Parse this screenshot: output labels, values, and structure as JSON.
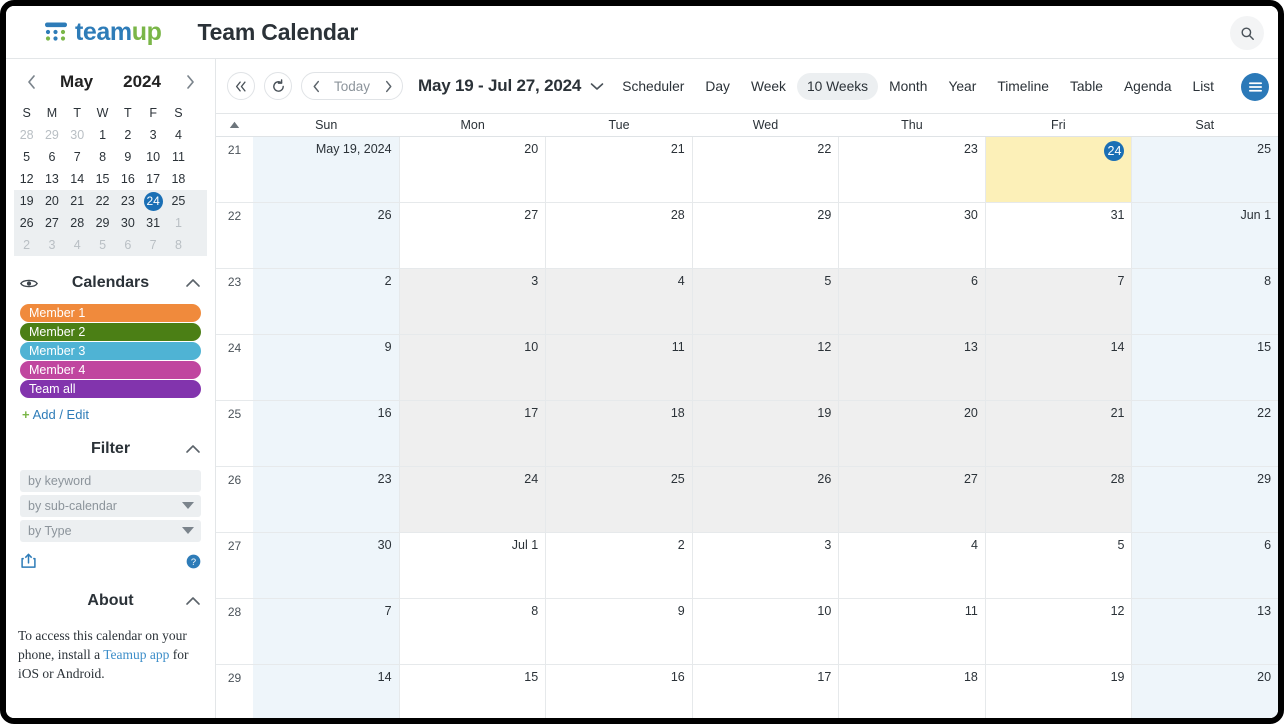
{
  "brand": {
    "logo_team": "team",
    "logo_up": "up",
    "logo_icon": "teamup-dots-logo"
  },
  "header": {
    "calendar_title": "Team Calendar",
    "search_icon": "search-icon"
  },
  "sidebar": {
    "minical": {
      "prev_icon": "chevron-left-icon",
      "next_icon": "chevron-right-icon",
      "month": "May",
      "year": "2024",
      "dow": [
        "S",
        "M",
        "T",
        "W",
        "T",
        "F",
        "S"
      ],
      "weeks": [
        {
          "selected": false,
          "days": [
            {
              "n": "28",
              "out": true
            },
            {
              "n": "29",
              "out": true
            },
            {
              "n": "30",
              "out": true
            },
            {
              "n": "1",
              "out": false
            },
            {
              "n": "2",
              "out": false
            },
            {
              "n": "3",
              "out": false
            },
            {
              "n": "4",
              "out": false
            }
          ]
        },
        {
          "selected": false,
          "days": [
            {
              "n": "5",
              "out": false
            },
            {
              "n": "6",
              "out": false
            },
            {
              "n": "7",
              "out": false
            },
            {
              "n": "8",
              "out": false
            },
            {
              "n": "9",
              "out": false
            },
            {
              "n": "10",
              "out": false
            },
            {
              "n": "11",
              "out": false
            }
          ]
        },
        {
          "selected": false,
          "days": [
            {
              "n": "12",
              "out": false
            },
            {
              "n": "13",
              "out": false
            },
            {
              "n": "14",
              "out": false
            },
            {
              "n": "15",
              "out": false
            },
            {
              "n": "16",
              "out": false
            },
            {
              "n": "17",
              "out": false
            },
            {
              "n": "18",
              "out": false
            }
          ]
        },
        {
          "selected": true,
          "days": [
            {
              "n": "19",
              "out": false
            },
            {
              "n": "20",
              "out": false
            },
            {
              "n": "21",
              "out": false
            },
            {
              "n": "22",
              "out": false
            },
            {
              "n": "23",
              "out": false
            },
            {
              "n": "24",
              "out": false,
              "today": true
            },
            {
              "n": "25",
              "out": false
            }
          ]
        },
        {
          "selected": true,
          "days": [
            {
              "n": "26",
              "out": false
            },
            {
              "n": "27",
              "out": false
            },
            {
              "n": "28",
              "out": false
            },
            {
              "n": "29",
              "out": false
            },
            {
              "n": "30",
              "out": false
            },
            {
              "n": "31",
              "out": false
            },
            {
              "n": "1",
              "out": true
            }
          ]
        },
        {
          "selected": true,
          "days": [
            {
              "n": "2",
              "out": true
            },
            {
              "n": "3",
              "out": true
            },
            {
              "n": "4",
              "out": true
            },
            {
              "n": "5",
              "out": true
            },
            {
              "n": "6",
              "out": true
            },
            {
              "n": "7",
              "out": true
            },
            {
              "n": "8",
              "out": true
            }
          ]
        }
      ]
    },
    "calendars_section": {
      "eye_icon": "eye-icon",
      "title": "Calendars",
      "collapse_icon": "chevron-up-icon",
      "items": [
        {
          "label": "Member 1",
          "color": "#f08a3c"
        },
        {
          "label": "Member 2",
          "color": "#4b7f15"
        },
        {
          "label": "Member 3",
          "color": "#4fb3d4"
        },
        {
          "label": "Member 4",
          "color": "#c0469f"
        },
        {
          "label": "Team all",
          "color": "#8234ad"
        }
      ],
      "add_edit_label": "Add / Edit",
      "add_edit_plus": "+"
    },
    "filter_section": {
      "title": "Filter",
      "collapse_icon": "chevron-up-icon",
      "keyword_placeholder": "by keyword",
      "subcalendar_label": "by sub-calendar",
      "type_label": "by Type",
      "share_icon": "share-icon",
      "help_icon": "help-icon"
    },
    "about_section": {
      "title": "About",
      "collapse_icon": "chevron-up-icon",
      "text_before": "To access this calendar on your phone, install a ",
      "link_label": "Teamup app",
      "text_after": " for iOS or Android."
    }
  },
  "toolbar": {
    "collapse_icon": "double-chevron-left-icon",
    "refresh_icon": "refresh-icon",
    "prev_icon": "chevron-left-icon",
    "today_label": "Today",
    "next_icon": "chevron-right-icon",
    "range_label": "May 19 - Jul 27, 2024",
    "range_caret_icon": "chevron-down-icon",
    "views": [
      {
        "label": "Scheduler",
        "active": false
      },
      {
        "label": "Day",
        "active": false
      },
      {
        "label": "Week",
        "active": false
      },
      {
        "label": "10 Weeks",
        "active": true
      },
      {
        "label": "Month",
        "active": false
      },
      {
        "label": "Year",
        "active": false
      },
      {
        "label": "Timeline",
        "active": false
      },
      {
        "label": "Table",
        "active": false
      },
      {
        "label": "Agenda",
        "active": false
      },
      {
        "label": "List",
        "active": false
      }
    ],
    "menu_icon": "hamburger-menu-icon"
  },
  "grid": {
    "sort_icon": "sort-ascending-icon",
    "dow": [
      "Sun",
      "Mon",
      "Tue",
      "Wed",
      "Thu",
      "Fri",
      "Sat"
    ],
    "weeks": [
      {
        "wk": "21",
        "days": [
          {
            "label": "May 19, 2024",
            "state": "weekend"
          },
          {
            "label": "20",
            "state": "normal"
          },
          {
            "label": "21",
            "state": "normal"
          },
          {
            "label": "22",
            "state": "normal"
          },
          {
            "label": "23",
            "state": "normal"
          },
          {
            "label": "24",
            "state": "today",
            "circled": true
          },
          {
            "label": "25",
            "state": "weekend"
          }
        ]
      },
      {
        "wk": "22",
        "days": [
          {
            "label": "26",
            "state": "weekend"
          },
          {
            "label": "27",
            "state": "normal"
          },
          {
            "label": "28",
            "state": "normal"
          },
          {
            "label": "29",
            "state": "normal"
          },
          {
            "label": "30",
            "state": "normal"
          },
          {
            "label": "31",
            "state": "normal"
          },
          {
            "label": "Jun 1",
            "state": "weekend"
          }
        ]
      },
      {
        "wk": "23",
        "days": [
          {
            "label": "2",
            "state": "weekend"
          },
          {
            "label": "3",
            "state": "offmonth"
          },
          {
            "label": "4",
            "state": "offmonth"
          },
          {
            "label": "5",
            "state": "offmonth"
          },
          {
            "label": "6",
            "state": "offmonth"
          },
          {
            "label": "7",
            "state": "offmonth"
          },
          {
            "label": "8",
            "state": "weekend"
          }
        ]
      },
      {
        "wk": "24",
        "days": [
          {
            "label": "9",
            "state": "weekend"
          },
          {
            "label": "10",
            "state": "offmonth"
          },
          {
            "label": "11",
            "state": "offmonth"
          },
          {
            "label": "12",
            "state": "offmonth"
          },
          {
            "label": "13",
            "state": "offmonth"
          },
          {
            "label": "14",
            "state": "offmonth"
          },
          {
            "label": "15",
            "state": "weekend"
          }
        ]
      },
      {
        "wk": "25",
        "days": [
          {
            "label": "16",
            "state": "weekend"
          },
          {
            "label": "17",
            "state": "offmonth"
          },
          {
            "label": "18",
            "state": "offmonth"
          },
          {
            "label": "19",
            "state": "offmonth"
          },
          {
            "label": "20",
            "state": "offmonth"
          },
          {
            "label": "21",
            "state": "offmonth"
          },
          {
            "label": "22",
            "state": "weekend"
          }
        ]
      },
      {
        "wk": "26",
        "days": [
          {
            "label": "23",
            "state": "weekend"
          },
          {
            "label": "24",
            "state": "offmonth"
          },
          {
            "label": "25",
            "state": "offmonth"
          },
          {
            "label": "26",
            "state": "offmonth"
          },
          {
            "label": "27",
            "state": "offmonth"
          },
          {
            "label": "28",
            "state": "offmonth"
          },
          {
            "label": "29",
            "state": "weekend"
          }
        ]
      },
      {
        "wk": "27",
        "days": [
          {
            "label": "30",
            "state": "weekend"
          },
          {
            "label": "Jul 1",
            "state": "normal"
          },
          {
            "label": "2",
            "state": "normal"
          },
          {
            "label": "3",
            "state": "normal"
          },
          {
            "label": "4",
            "state": "normal"
          },
          {
            "label": "5",
            "state": "normal"
          },
          {
            "label": "6",
            "state": "weekend"
          }
        ]
      },
      {
        "wk": "28",
        "days": [
          {
            "label": "7",
            "state": "weekend"
          },
          {
            "label": "8",
            "state": "normal"
          },
          {
            "label": "9",
            "state": "normal"
          },
          {
            "label": "10",
            "state": "normal"
          },
          {
            "label": "11",
            "state": "normal"
          },
          {
            "label": "12",
            "state": "normal"
          },
          {
            "label": "13",
            "state": "weekend"
          }
        ]
      },
      {
        "wk": "29",
        "days": [
          {
            "label": "14",
            "state": "weekend"
          },
          {
            "label": "15",
            "state": "normal"
          },
          {
            "label": "16",
            "state": "normal"
          },
          {
            "label": "17",
            "state": "normal"
          },
          {
            "label": "18",
            "state": "normal"
          },
          {
            "label": "19",
            "state": "normal"
          },
          {
            "label": "20",
            "state": "weekend"
          }
        ]
      }
    ]
  }
}
